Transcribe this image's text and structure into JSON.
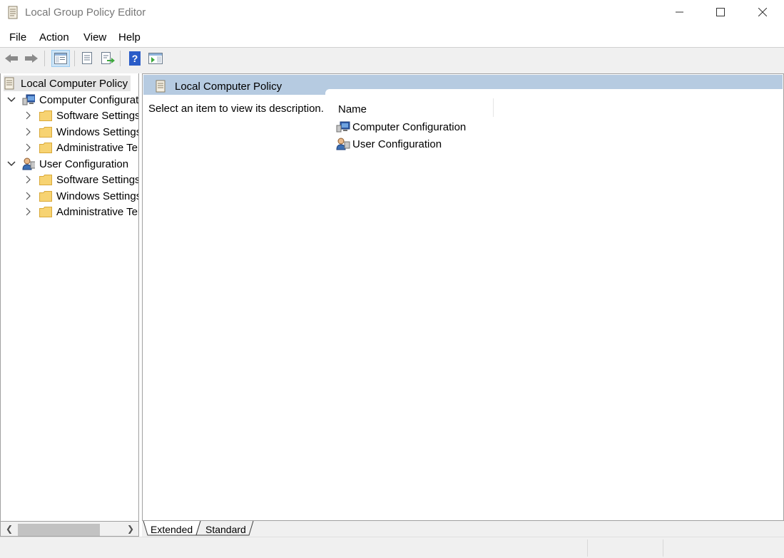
{
  "window": {
    "title": "Local Group Policy Editor",
    "controls": {
      "minimize_icon": "minimize-icon",
      "maximize_icon": "maximize-icon",
      "close_icon": "close-icon"
    }
  },
  "menu": {
    "file": "File",
    "action": "Action",
    "view": "View",
    "help": "Help"
  },
  "toolbar": {
    "buttons": [
      "back-icon",
      "forward-icon",
      "show-hide-console-tree-icon",
      "properties-icon",
      "export-list-icon",
      "help-icon",
      "show-hide-action-pane-icon"
    ]
  },
  "tree": {
    "root": "Local Computer Policy",
    "computer": {
      "label": "Computer Configuration",
      "children": [
        "Software Settings",
        "Windows Settings",
        "Administrative Templates"
      ]
    },
    "user": {
      "label": "User Configuration",
      "children": [
        "Software Settings",
        "Windows Settings",
        "Administrative Templates"
      ]
    }
  },
  "details": {
    "title": "Local Computer Policy",
    "description": "Select an item to view its description.",
    "column_name": "Name",
    "items": [
      "Computer Configuration",
      "User Configuration"
    ]
  },
  "tabs": {
    "extended": "Extended",
    "standard": "Standard"
  },
  "colors": {
    "header_bg": "#b6cbe1",
    "selection_bg": "#e5e5e5",
    "folder": "#f0c75e"
  }
}
